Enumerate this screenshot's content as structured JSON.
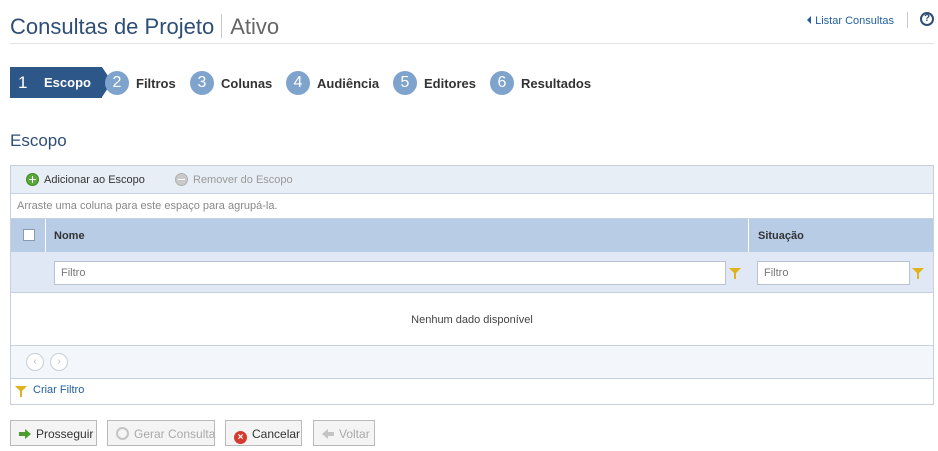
{
  "header": {
    "title": "Consultas de Projeto",
    "status": "Ativo",
    "list_link": "Listar Consultas",
    "help_label": "?"
  },
  "steps": [
    {
      "num": "1",
      "label": "Escopo",
      "active": true
    },
    {
      "num": "2",
      "label": "Filtros"
    },
    {
      "num": "3",
      "label": "Colunas"
    },
    {
      "num": "4",
      "label": "Audiência"
    },
    {
      "num": "5",
      "label": "Editores"
    },
    {
      "num": "6",
      "label": "Resultados"
    }
  ],
  "section_title": "Escopo",
  "grid": {
    "toolbar": {
      "add_label": "Adicionar ao Escopo",
      "remove_label": "Remover do Escopo"
    },
    "group_hint": "Arraste uma coluna para este espaço para agrupá-la.",
    "columns": [
      "Nome",
      "Situação"
    ],
    "filter_placeholders": [
      "Filtro",
      "Filtro"
    ],
    "empty_message": "Nenhum dado disponível",
    "create_filter": "Criar Filtro"
  },
  "actions": {
    "proceed": "Prosseguir",
    "generate": "Gerar Consulta",
    "cancel": "Cancelar",
    "back": "Voltar"
  },
  "colors": {
    "primary": "#2e5789",
    "step_inactive": "#7ea3cc",
    "header_blue": "#b8cce6",
    "link": "#1f5f9e"
  }
}
